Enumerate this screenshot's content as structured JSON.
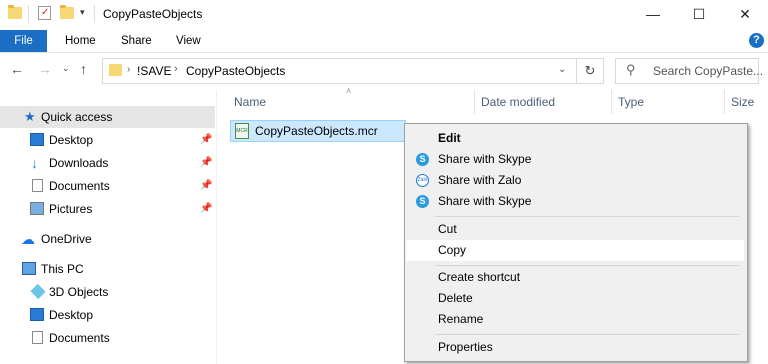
{
  "window": {
    "title": "CopyPasteObjects",
    "controls": {
      "minimize": "—",
      "maximize": "☐",
      "close": "✕"
    }
  },
  "ribbon": {
    "tabs": [
      "File",
      "Home",
      "Share",
      "View"
    ],
    "collapse_glyph": "⌄",
    "help_glyph": "?"
  },
  "address": {
    "path": [
      "!SAVE",
      "CopyPasteObjects"
    ],
    "search_placeholder": "Search CopyPaste..."
  },
  "nav_pane": {
    "quick_access": "Quick access",
    "pinned": [
      "Desktop",
      "Downloads",
      "Documents",
      "Pictures"
    ],
    "onedrive": "OneDrive",
    "this_pc": "This PC",
    "pc_items": [
      "3D Objects",
      "Desktop",
      "Documents"
    ]
  },
  "columns": [
    "Name",
    "Date modified",
    "Type",
    "Size"
  ],
  "files": [
    {
      "name": "CopyPasteObjects.mcr",
      "icon": "mcr-file-icon"
    }
  ],
  "context_menu": {
    "group1": [
      "Edit",
      "Share with Skype",
      "Share with Zalo",
      "Share with Skype"
    ],
    "group2": [
      "Cut",
      "Copy"
    ],
    "group3": [
      "Create shortcut",
      "Delete",
      "Rename"
    ],
    "group4": [
      "Properties"
    ],
    "highlighted": "Copy",
    "zalo_icon_text": "Zalo",
    "skype_icon_text": "S"
  },
  "colors": {
    "file_tab": "#1a6fc4",
    "selection": "#cce8ff",
    "nav_selected": "#e5e5e5",
    "menu_bg": "#f0f0f0",
    "skype": "#2a9bdf",
    "zalo": "#1a74e8"
  }
}
